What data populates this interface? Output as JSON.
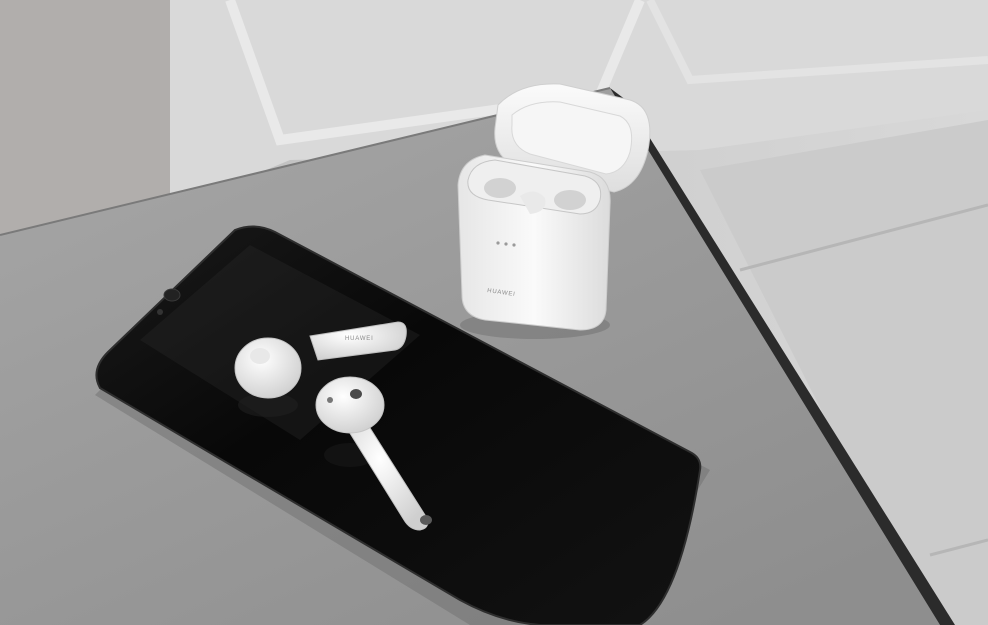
{
  "photo": {
    "subject": "phone-with-earbuds-and-case",
    "palette": {
      "background_left": "#b9b9b9",
      "background_right": "#d2d2d2",
      "floor_panel": "#cfcfcf",
      "table_top": "#9d9d9d",
      "table_edge": "#2a2a2a",
      "phone_body": "#0e0e0e",
      "earbud_white": "#f2f2f2",
      "case_white": "#f4f4f4"
    },
    "case_brand": "HUAWEI",
    "earbud_brand": "HUAWEI"
  }
}
